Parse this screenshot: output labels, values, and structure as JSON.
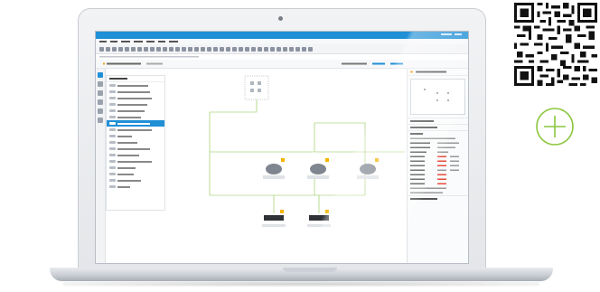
{
  "qr_code": {
    "icon": "qr-code-icon"
  },
  "add_button": {
    "icon": "plus-circle-icon",
    "color": "#8cc63f"
  },
  "laptop": {
    "app": {
      "accent_color": "#1f8fd6",
      "palette_items_count_visible": 16,
      "selected_palette_index": 6
    }
  }
}
